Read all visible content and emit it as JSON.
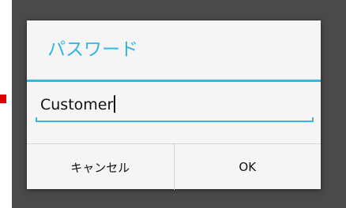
{
  "colors": {
    "accent": "#33b5e5",
    "marker": "#e00000",
    "backdrop": "#4a4a4a",
    "dialog": "#f5f5f5"
  },
  "dialog": {
    "title": "パスワード",
    "input": {
      "value": "Customer"
    },
    "buttons": {
      "cancel_label": "キャンセル",
      "ok_label": "OK"
    }
  }
}
